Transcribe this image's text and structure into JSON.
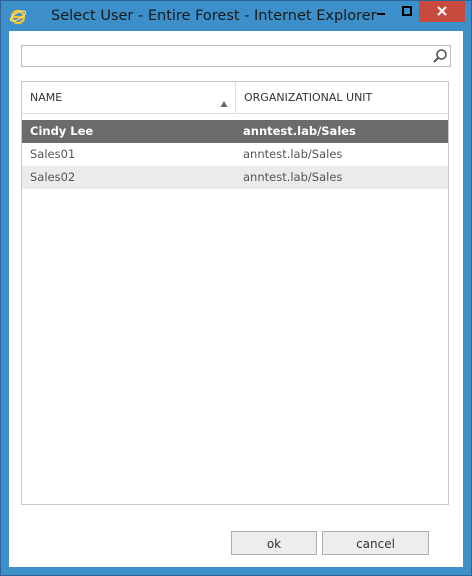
{
  "window": {
    "title": "Select User - Entire Forest - Internet Explorer",
    "app_icon": "internet-explorer-icon",
    "controls": [
      "minimize-icon",
      "maximize-icon",
      "close-icon"
    ],
    "accent_color": "#3c8fc9",
    "close_color": "#c74a3d"
  },
  "search": {
    "value": "",
    "placeholder": "",
    "icon": "search-icon"
  },
  "grid": {
    "columns": [
      "NAME",
      "ORGANIZATIONAL UNIT"
    ],
    "sort": "ascending",
    "rows": [
      {
        "name": "Cindy Lee",
        "ou": "anntest.lab/Sales",
        "selected": true
      },
      {
        "name": "Sales01",
        "ou": "anntest.lab/Sales",
        "selected": false
      },
      {
        "name": "Sales02",
        "ou": "anntest.lab/Sales",
        "selected": false
      }
    ],
    "selected_color": "#6b6b6b"
  },
  "actions": {
    "ok_label": "ok",
    "cancel_label": "cancel"
  }
}
